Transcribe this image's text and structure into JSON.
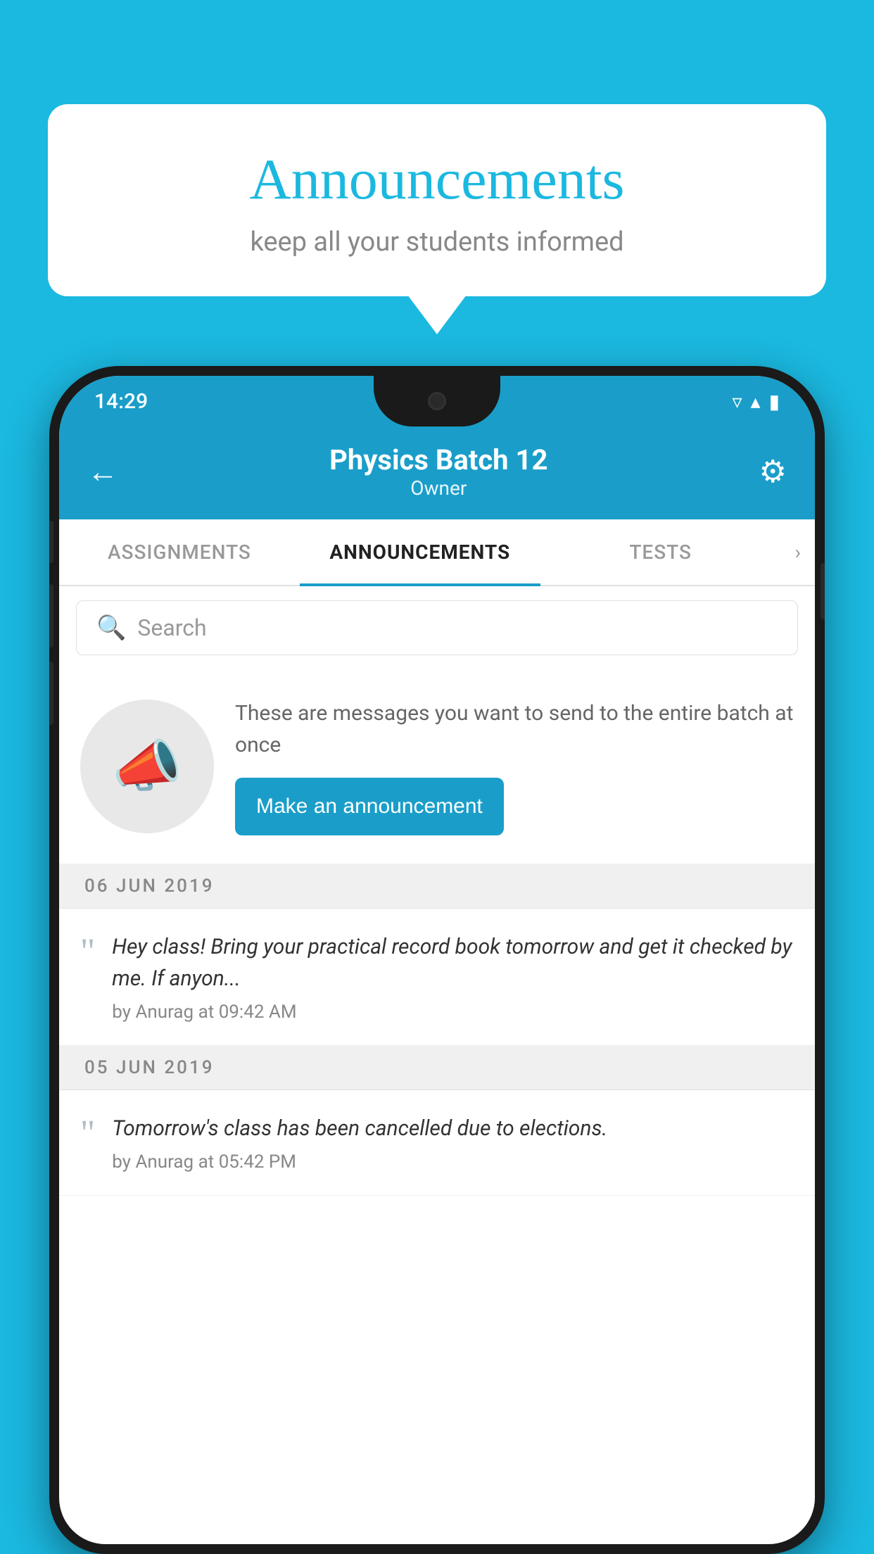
{
  "background_color": "#1bb8e0",
  "speech_bubble": {
    "title": "Announcements",
    "subtitle": "keep all your students informed"
  },
  "phone": {
    "status_bar": {
      "time": "14:29",
      "wifi": "▾",
      "signal": "▴",
      "battery": "▮"
    },
    "header": {
      "back_label": "←",
      "title": "Physics Batch 12",
      "subtitle": "Owner",
      "gear_label": "⚙"
    },
    "tabs": [
      {
        "label": "ASSIGNMENTS",
        "active": false
      },
      {
        "label": "ANNOUNCEMENTS",
        "active": true
      },
      {
        "label": "TESTS",
        "active": false
      }
    ],
    "tab_more": "›",
    "search": {
      "placeholder": "Search"
    },
    "cta": {
      "description": "These are messages you want to send to the entire batch at once",
      "button_label": "Make an announcement"
    },
    "announcements": [
      {
        "date": "06  JUN  2019",
        "message": "Hey class! Bring your practical record book tomorrow and get it checked by me. If anyon...",
        "author": "by Anurag at 09:42 AM"
      },
      {
        "date": "05  JUN  2019",
        "message": "Tomorrow's class has been cancelled due to elections.",
        "author": "by Anurag at 05:42 PM"
      }
    ]
  }
}
